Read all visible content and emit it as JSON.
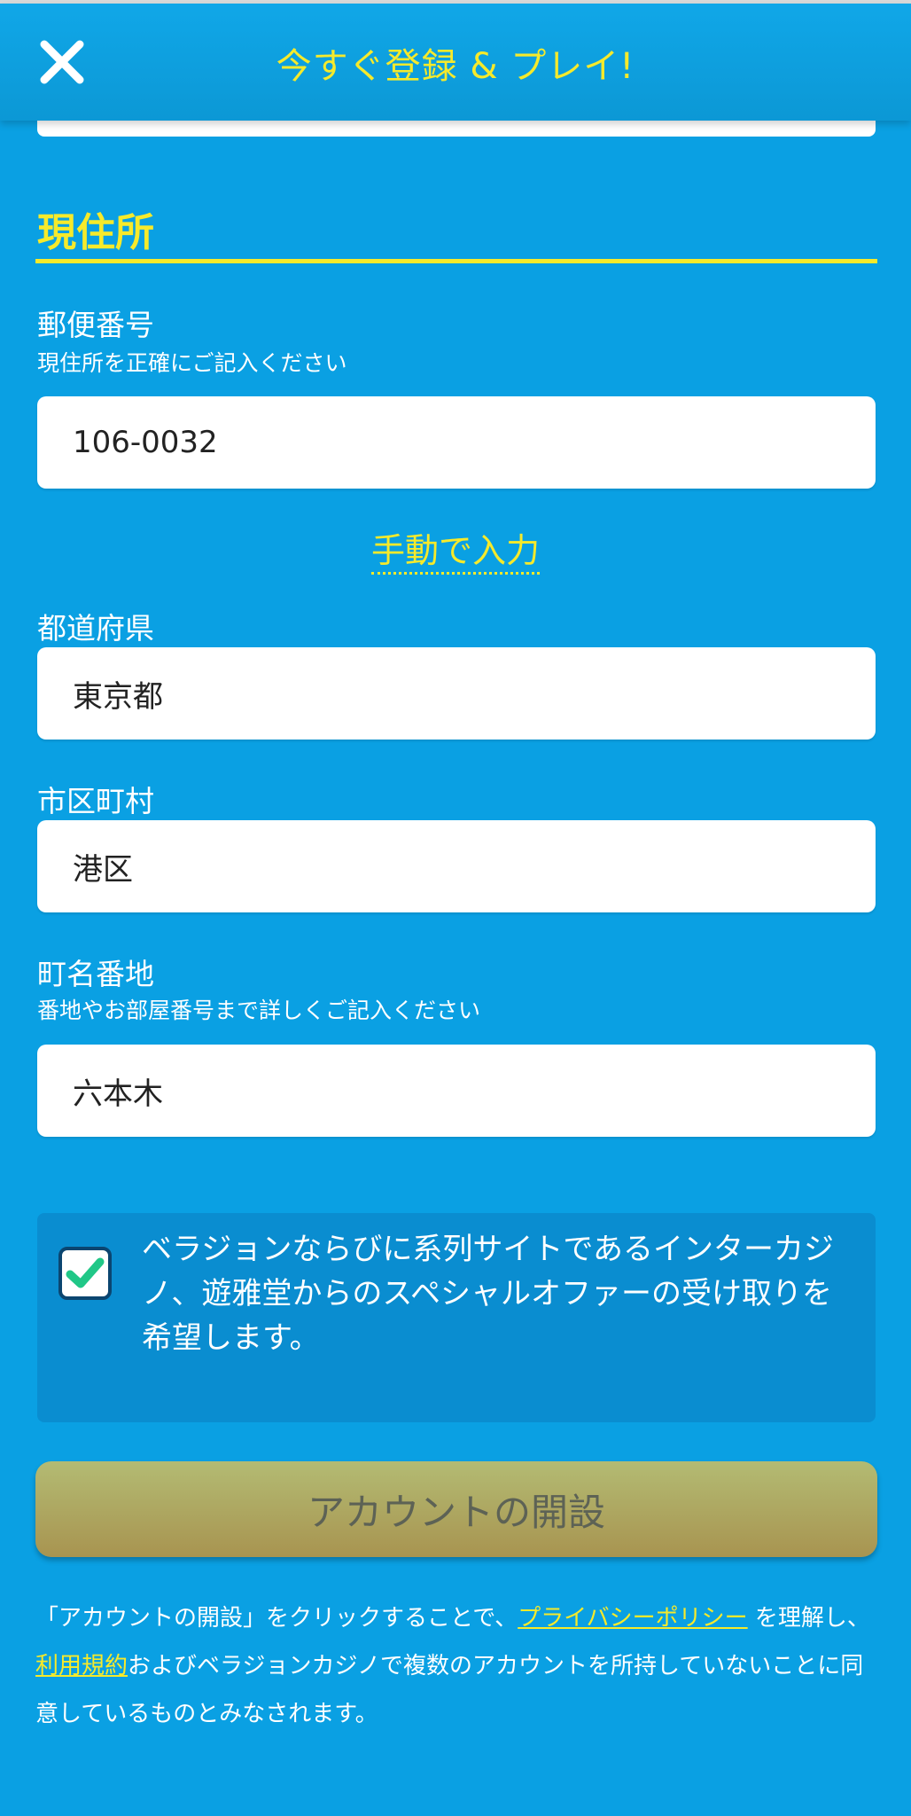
{
  "header": {
    "title": "今すぐ登録 & プレイ!",
    "close_icon": "close-icon"
  },
  "section": {
    "title": "現住所"
  },
  "postal": {
    "label": "郵便番号",
    "hint": "現住所を正確にご記入ください",
    "value": "106-0032"
  },
  "manual_entry_link": "手動で入力",
  "prefecture": {
    "label": "都道府県",
    "value": "東京都"
  },
  "city": {
    "label": "市区町村",
    "value": "港区"
  },
  "street": {
    "label": "町名番地",
    "hint": "番地やお部屋番号まで詳しくご記入ください",
    "value": "六本木"
  },
  "consent": {
    "checked": true,
    "text": "ベラジョンならびに系列サイトであるインターカジノ、遊雅堂からのスペシャルオファーの受け取りを希望します。"
  },
  "submit_button": "アカウントの開設",
  "terms": {
    "part1": "「アカウントの開設」をクリックすることで、",
    "privacy_link": "プライバシーポリシー",
    "part2": " を理解し、",
    "terms_link": "利用規約",
    "part3": "およびベラジョンカジノで複数のアカウントを所持していないことに同意しているものとみなされます。"
  },
  "colors": {
    "background": "#0aa0e3",
    "accent_yellow": "#f6ea2b",
    "check_green": "#20c787",
    "button_gold": "#b3bb73"
  }
}
